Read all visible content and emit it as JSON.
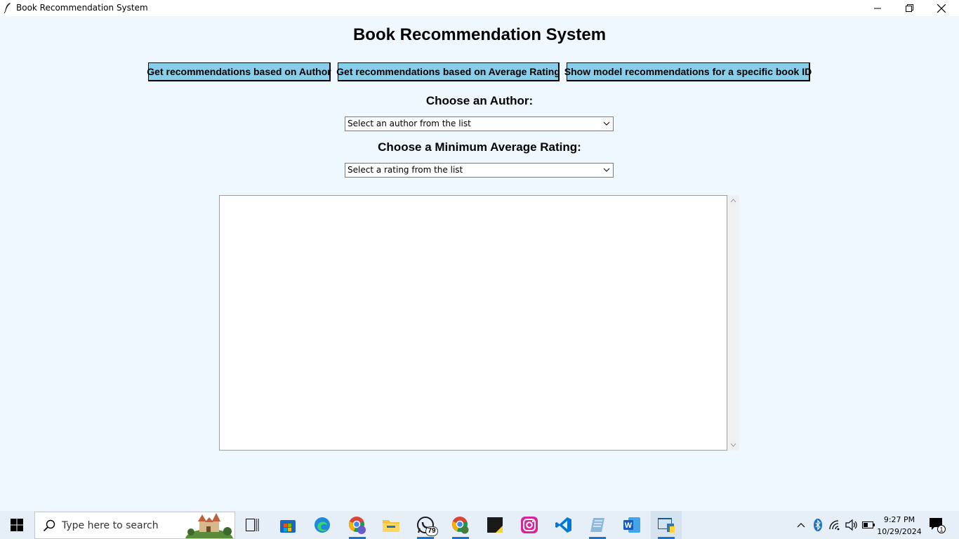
{
  "window": {
    "title": "Book Recommendation System"
  },
  "main": {
    "heading": "Book Recommendation System",
    "buttons": {
      "author": "Get recommendations based on Author",
      "rating": "Get recommendations based on Average Rating",
      "book_id": "Show model recommendations for a specific book ID"
    },
    "author_label": "Choose an Author:",
    "author_select": "Select an author from the list",
    "rating_label": "Choose a Minimum Average Rating:",
    "rating_select": "Select a rating from the list"
  },
  "colors": {
    "background": "#f0f8ff",
    "button": "#87ceeb"
  },
  "taskbar": {
    "search_placeholder": "Type here to search",
    "apps": [
      "task-view",
      "microsoft-store",
      "edge",
      "chrome-profile",
      "file-explorer",
      "whatsapp",
      "chrome",
      "sticky-notes",
      "instagram",
      "vscode",
      "notepad",
      "word",
      "python"
    ],
    "whatsapp_badge": "79",
    "time": "9:27 PM",
    "date": "10/29/2024",
    "notification_count": "1"
  }
}
